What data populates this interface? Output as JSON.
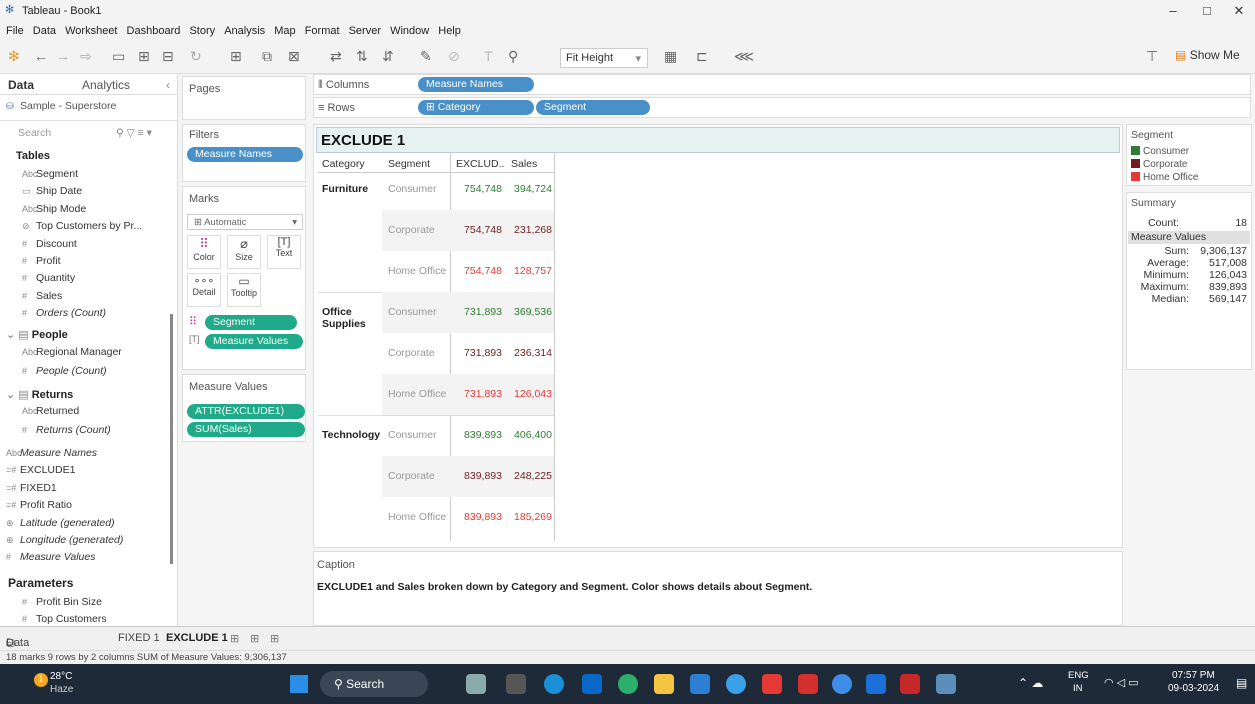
{
  "window": {
    "title": "Tableau - Book1"
  },
  "menu": [
    "File",
    "Data",
    "Worksheet",
    "Dashboard",
    "Story",
    "Analysis",
    "Map",
    "Format",
    "Server",
    "Window",
    "Help"
  ],
  "toolbar": {
    "fit": "Fit Height",
    "show_me": "Show Me"
  },
  "left": {
    "tab_data": "Data",
    "tab_analytics": "Analytics",
    "datasource": "Sample - Superstore",
    "search_placeholder": "Search",
    "tables_header": "Tables",
    "orders_fields": [
      {
        "icon": "Abc",
        "label": "Segment",
        "italic": false
      },
      {
        "icon": "▭",
        "label": "Ship Date",
        "italic": false
      },
      {
        "icon": "Abc",
        "label": "Ship Mode",
        "italic": false
      },
      {
        "icon": "⊘",
        "label": "Top Customers by Pr...",
        "italic": false
      },
      {
        "icon": "#",
        "label": "Discount",
        "italic": false
      },
      {
        "icon": "#",
        "label": "Profit",
        "italic": false
      },
      {
        "icon": "#",
        "label": "Quantity",
        "italic": false
      },
      {
        "icon": "#",
        "label": "Sales",
        "italic": false
      },
      {
        "icon": "#",
        "label": "Orders (Count)",
        "italic": true
      }
    ],
    "people_header": "People",
    "people_fields": [
      {
        "icon": "Abc",
        "label": "Regional Manager",
        "italic": false
      },
      {
        "icon": "#",
        "label": "People (Count)",
        "italic": true
      }
    ],
    "returns_header": "Returns",
    "returns_fields": [
      {
        "icon": "Abc",
        "label": "Returned",
        "italic": false
      },
      {
        "icon": "#",
        "label": "Returns (Count)",
        "italic": true
      }
    ],
    "other_fields": [
      {
        "icon": "Abc",
        "label": "Measure Names",
        "italic": true
      },
      {
        "icon": "=#",
        "label": "EXCLUDE1",
        "italic": false
      },
      {
        "icon": "=#",
        "label": "FIXED1",
        "italic": false
      },
      {
        "icon": "=#",
        "label": "Profit Ratio",
        "italic": false
      },
      {
        "icon": "⊕",
        "label": "Latitude (generated)",
        "italic": true
      },
      {
        "icon": "⊕",
        "label": "Longitude (generated)",
        "italic": true
      },
      {
        "icon": "#",
        "label": "Measure Values",
        "italic": true
      }
    ],
    "parameters_header": "Parameters",
    "parameters": [
      {
        "icon": "#",
        "label": "Profit Bin Size"
      },
      {
        "icon": "#",
        "label": "Top Customers"
      }
    ]
  },
  "cards": {
    "pages": "Pages",
    "filters": "Filters",
    "filter_pill": "Measure Names",
    "marks": "Marks",
    "mark_type": "Automatic",
    "mark_buttons": [
      "Color",
      "Size",
      "Text",
      "Detail",
      "Tooltip"
    ],
    "marks_pills": [
      "Segment",
      "Measure Values"
    ],
    "measure_values": "Measure Values",
    "mv_pills": [
      "ATTR(EXCLUDE1)",
      "SUM(Sales)"
    ]
  },
  "shelves": {
    "columns_label": "Columns",
    "rows_label": "Rows",
    "columns_pills": [
      "Measure Names"
    ],
    "rows_pills": [
      "Category",
      "Segment"
    ]
  },
  "viz": {
    "title": "EXCLUDE 1",
    "headers": [
      "Category",
      "Segment",
      "EXCLUD..",
      "Sales"
    ],
    "categories": [
      "Furniture",
      "Office Supplies",
      "Technology"
    ],
    "rows": [
      {
        "segment": "Consumer",
        "exclude": "754,748",
        "sales": "394,724"
      },
      {
        "segment": "Corporate",
        "exclude": "754,748",
        "sales": "231,268"
      },
      {
        "segment": "Home Office",
        "exclude": "754,748",
        "sales": "128,757"
      },
      {
        "segment": "Consumer",
        "exclude": "731,893",
        "sales": "369,536"
      },
      {
        "segment": "Corporate",
        "exclude": "731,893",
        "sales": "236,314"
      },
      {
        "segment": "Home Office",
        "exclude": "731,893",
        "sales": "126,043"
      },
      {
        "segment": "Consumer",
        "exclude": "839,893",
        "sales": "406,400"
      },
      {
        "segment": "Corporate",
        "exclude": "839,893",
        "sales": "248,225"
      },
      {
        "segment": "Home Office",
        "exclude": "839,893",
        "sales": "185,269"
      }
    ],
    "segment_colors": {
      "Consumer": "#2e7d32",
      "Corporate": "#6d1f1f",
      "Home Office": "#e53935"
    }
  },
  "caption": {
    "label": "Caption",
    "text": "EXCLUDE1 and Sales broken down by Category and Segment.  Color shows details about Segment."
  },
  "legend": {
    "title": "Segment",
    "items": [
      "Consumer",
      "Corporate",
      "Home Office"
    ]
  },
  "summary": {
    "title": "Summary",
    "count_label": "Count:",
    "count": "18",
    "mv_label": "Measure Values",
    "stats": [
      {
        "label": "Sum:",
        "value": "9,306,137"
      },
      {
        "label": "Average:",
        "value": "517,008"
      },
      {
        "label": "Minimum:",
        "value": "126,043"
      },
      {
        "label": "Maximum:",
        "value": "839,893"
      },
      {
        "label": "Median:",
        "value": "569,147"
      }
    ]
  },
  "sheets": {
    "data_source": "Data Source",
    "tabs": [
      "FIXED 1",
      "EXCLUDE 1"
    ]
  },
  "status": "18 marks   9 rows by 2 columns    SUM of Measure Values: 9,306,137",
  "taskbar": {
    "temp": "28°C",
    "weather": "Haze",
    "search": "Search",
    "lang": "ENG",
    "region": "IN",
    "time": "07:57 PM",
    "date": "09-03-2024",
    "badge": "1"
  }
}
